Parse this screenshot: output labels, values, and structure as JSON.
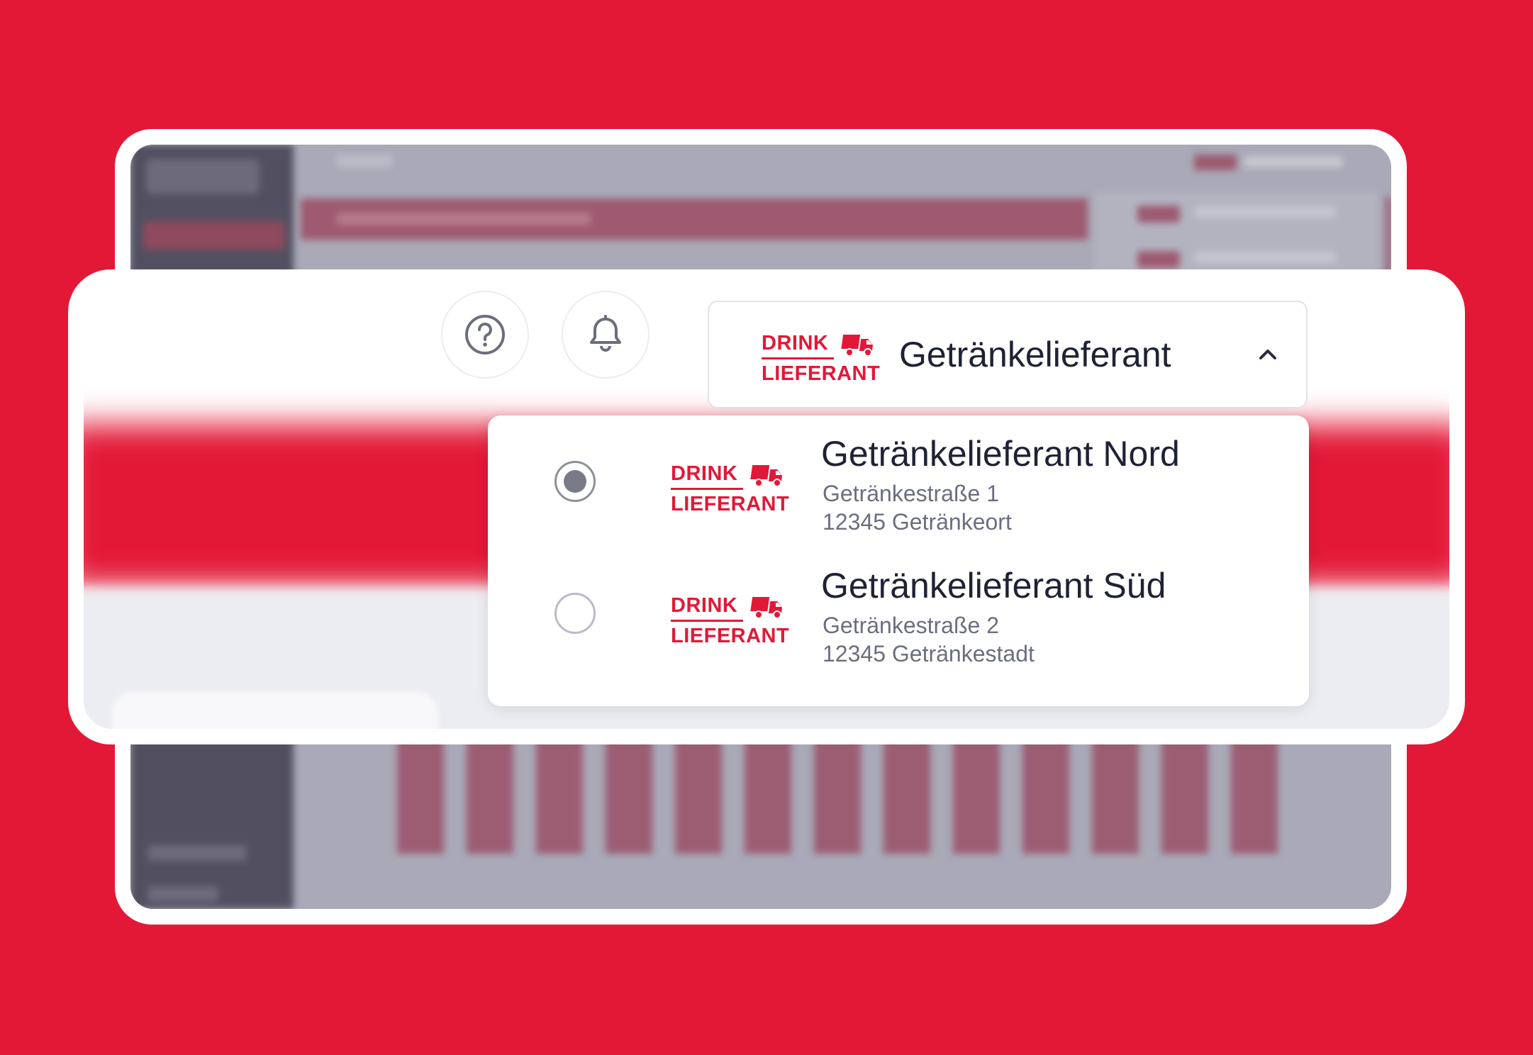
{
  "header": {
    "help_icon": "question-circle-icon",
    "notification_icon": "bell-icon"
  },
  "selector": {
    "title": "Getränkelieferant",
    "expanded": true,
    "chevron_icon": "chevron-up-icon"
  },
  "brand": {
    "logo_line1": "DRINK",
    "logo_line2": "LIEFERANT",
    "logo_icon": "truck-icon",
    "color": "#e31837"
  },
  "options": [
    {
      "name": "Getränkelieferant Nord",
      "street": "Getränkestraße 1",
      "city": "12345 Getränkeort",
      "selected": true
    },
    {
      "name": "Getränkelieferant Süd",
      "street": "Getränkestraße 2",
      "city": "12345 Getränkestadt",
      "selected": false
    }
  ],
  "colors": {
    "background": "#e31837",
    "text": "#1f2235",
    "muted_text": "#6b6e80"
  }
}
